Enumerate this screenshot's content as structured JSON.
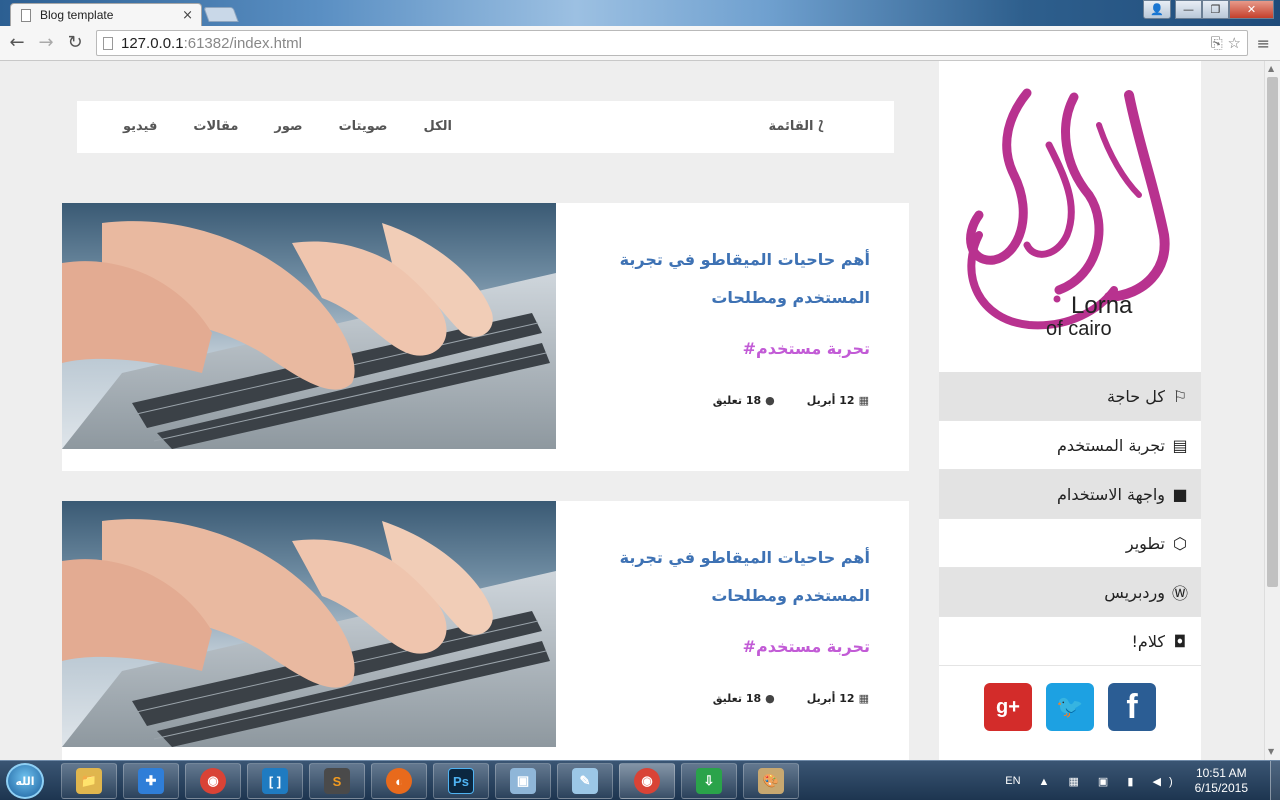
{
  "browser": {
    "tab_title": "Blog template",
    "tab_close": "×",
    "url_host": "127.0.0.1",
    "url_rest": ":61382/index.html",
    "nav": {
      "back": "←",
      "forward": "→",
      "reload": "↻"
    },
    "menu_icon": "≡",
    "window_buttons": {
      "user": "👤",
      "minimize": "—",
      "maximize": "❐",
      "close": "✕"
    }
  },
  "topnav": {
    "menu_label": "القائمة",
    "filters": [
      "الكل",
      "صويتات",
      "صور",
      "مقالات",
      "فيديو"
    ]
  },
  "sidebar": {
    "logo_text_line1": "Lorna",
    "logo_text_line2": "of cairo",
    "menu": [
      {
        "label": "كل حاجة",
        "icon": "flag-icon",
        "glyph": "⚐"
      },
      {
        "label": "تجربة المستخدم",
        "icon": "newspaper-icon",
        "glyph": "▤"
      },
      {
        "label": "واجهة الاستخدام",
        "icon": "bookmark-icon",
        "glyph": "■"
      },
      {
        "label": "تطوير",
        "icon": "hexagon-icon",
        "glyph": "⬡"
      },
      {
        "label": "وردبريس",
        "icon": "wordpress-icon",
        "glyph": "Ⓦ"
      },
      {
        "label": "كلام!",
        "icon": "quote-icon",
        "glyph": "◘"
      }
    ],
    "social": {
      "googleplus": "g+",
      "twitter": "🐦",
      "facebook": "f"
    }
  },
  "posts": [
    {
      "title": "أهم حاحيات الميقاطو في تجربة المستخدم ومطلحات",
      "tag": "#تحربة مستخدم",
      "date": "12 أبريل",
      "comments": "18 تعليق"
    },
    {
      "title": "أهم حاحيات الميقاطو في تجربة المستخدم ومطلحات",
      "tag": "#تحربة مستخدم",
      "date": "12 أبريل",
      "comments": "18 تعليق"
    }
  ],
  "colors": {
    "post_title": "#3e72b4",
    "post_tag": "#c25bd6",
    "logo": "#b8328f",
    "sidebar_shade": "#e3e3e3"
  },
  "taskbar": {
    "start_label": "الله",
    "language": "EN",
    "time": "10:51 AM",
    "date": "6/15/2015",
    "apps": [
      {
        "name": "explorer",
        "glyph": "📁"
      },
      {
        "name": "puzzle",
        "glyph": "✚"
      },
      {
        "name": "chrome",
        "glyph": "◉"
      },
      {
        "name": "brackets",
        "glyph": "[ ]"
      },
      {
        "name": "sublime",
        "glyph": "S"
      },
      {
        "name": "firefox",
        "glyph": "◐"
      },
      {
        "name": "photoshop",
        "glyph": "Ps"
      },
      {
        "name": "box",
        "glyph": "▣"
      },
      {
        "name": "notes",
        "glyph": "✎"
      },
      {
        "name": "chrome-active",
        "glyph": "◉"
      },
      {
        "name": "download-manager",
        "glyph": "⇩"
      },
      {
        "name": "paint",
        "glyph": "🎨"
      }
    ]
  }
}
